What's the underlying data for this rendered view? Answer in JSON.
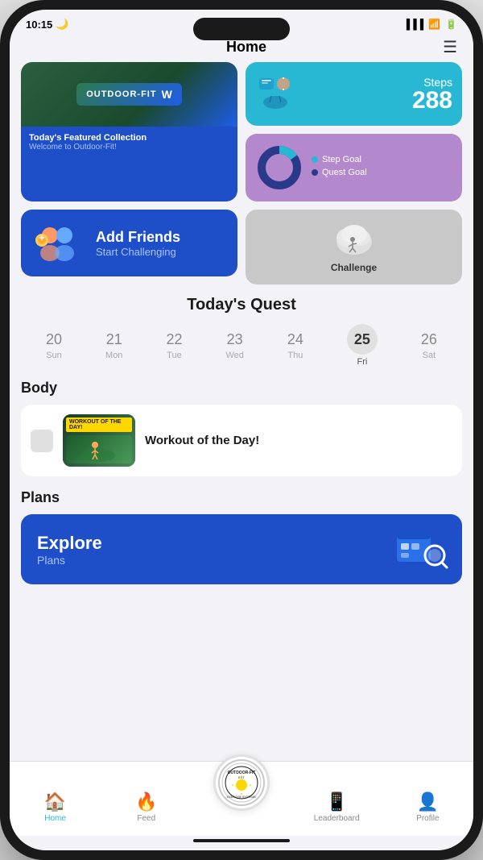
{
  "status_bar": {
    "time": "10:15",
    "battery_icon": "🔋",
    "wifi_icon": "📶",
    "signal_icon": "📶",
    "moon_icon": "🌙"
  },
  "header": {
    "title": "Home",
    "menu_icon": "☰"
  },
  "featured_card": {
    "logo_text": "OUTDOOR-FIT",
    "wi_text": "W",
    "caption_title": "Today's Featured Collection",
    "caption_sub": "Welcome to Outdoor-Fit!"
  },
  "steps_card": {
    "label": "Steps",
    "count": "288"
  },
  "goals_card": {
    "legend": [
      {
        "color": "#29b8d4",
        "label": "Step Goal"
      },
      {
        "color": "#2a3a8a",
        "label": "Quest Goal"
      }
    ],
    "donut": {
      "step_pct": 15,
      "quest_pct": 85
    }
  },
  "add_friends": {
    "title": "Add Friends",
    "subtitle": "Start Challenging"
  },
  "challenge": {
    "label": "Challenge"
  },
  "quest_section": {
    "title": "Today's Quest",
    "days": [
      {
        "num": "20",
        "label": "Sun",
        "active": false
      },
      {
        "num": "21",
        "label": "Mon",
        "active": false
      },
      {
        "num": "22",
        "label": "Tue",
        "active": false
      },
      {
        "num": "23",
        "label": "Wed",
        "active": false
      },
      {
        "num": "24",
        "label": "Thu",
        "active": false
      },
      {
        "num": "25",
        "label": "Fri",
        "active": true
      },
      {
        "num": "26",
        "label": "Sat",
        "active": false
      }
    ]
  },
  "body_section": {
    "title": "Body",
    "workout": {
      "name": "Workout of the Day!"
    }
  },
  "plans_section": {
    "title": "Plans",
    "card_title": "Explore",
    "card_subtitle": "Plans",
    "badge_line1": "OUTDOOR-FIT",
    "badge_line2": "EST",
    "badge_line3": "EXERCISE SYSTEMS"
  },
  "bottom_nav": {
    "items": [
      {
        "icon": "🏠",
        "label": "Home",
        "active": true
      },
      {
        "icon": "🔥",
        "label": "Feed",
        "active": false
      },
      {
        "icon": "",
        "label": "",
        "center": true
      },
      {
        "icon": "📱",
        "label": "Leaderboard",
        "active": false
      },
      {
        "icon": "👤",
        "label": "Profile",
        "active": false
      }
    ]
  }
}
